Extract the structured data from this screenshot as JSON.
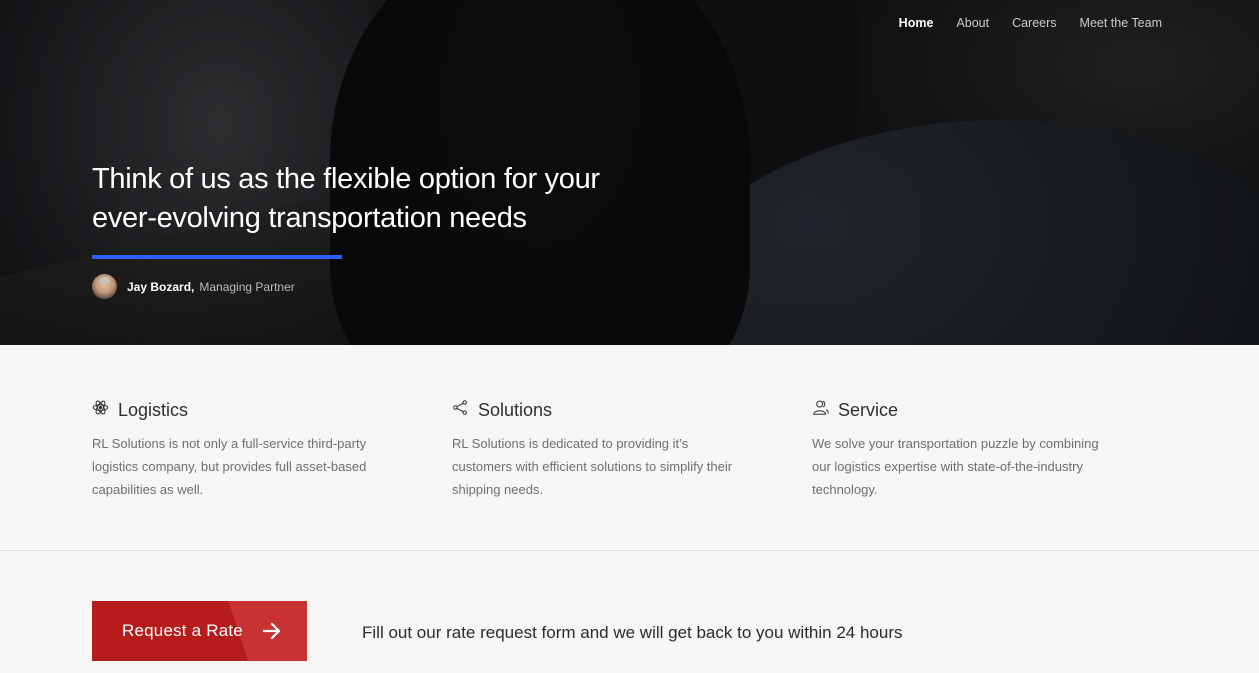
{
  "nav": {
    "items": [
      {
        "label": "Home",
        "active": true
      },
      {
        "label": "About",
        "active": false
      },
      {
        "label": "Careers",
        "active": false
      },
      {
        "label": "Meet the Team",
        "active": false
      }
    ]
  },
  "hero": {
    "title_line1": "Think of us as the flexible option for your",
    "title_line2": "ever-evolving transportation needs",
    "accent_color": "#2f5df5",
    "author": {
      "name": "Jay Bozard,",
      "role": "Managing Partner"
    }
  },
  "features": [
    {
      "icon": "atom-icon",
      "title": "Logistics",
      "description": "RL Solutions is not only a full-service third-party logistics company, but provides full asset-based capabilities as well."
    },
    {
      "icon": "share-icon",
      "title": "Solutions",
      "description": "RL Solutions is dedicated to providing it’s customers with efficient solutions to simplify their shipping needs."
    },
    {
      "icon": "users-icon",
      "title": "Service",
      "description": "We solve your transportation puzzle by combining our logistics expertise with state-of-the-industry technology."
    }
  ],
  "cta": {
    "button_label": "Request a Rate",
    "button_color": "#b71c1c",
    "text": "Fill out our rate request form and we will get back to you within 24 hours"
  }
}
